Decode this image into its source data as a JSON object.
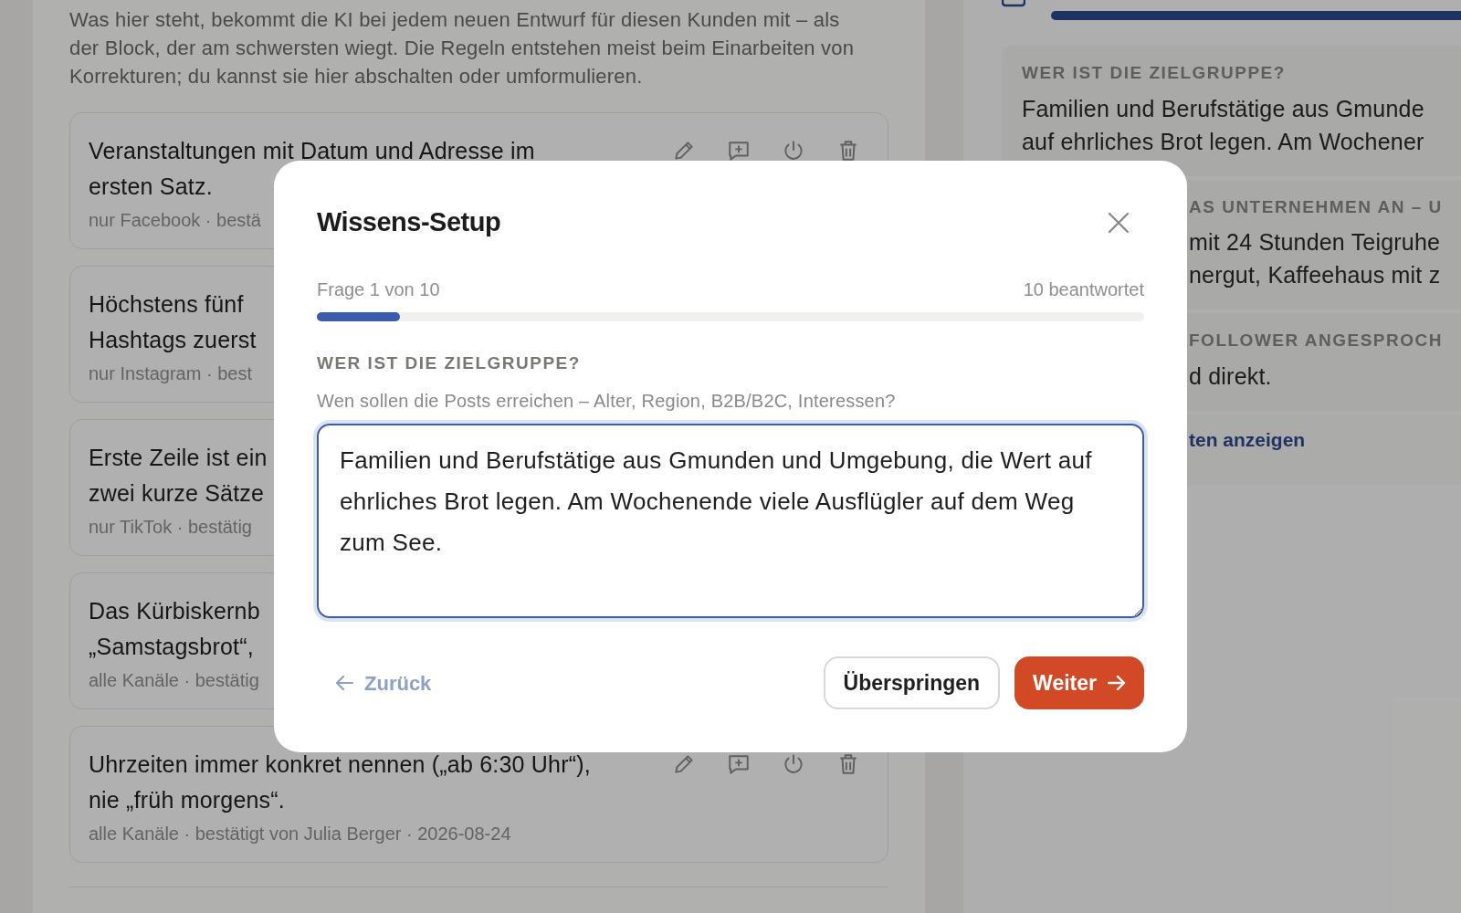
{
  "intro": "Was hier steht, bekommt die KI bei jedem neuen Entwurf für diesen Kunden mit – als der Block, der am schwersten wiegt. Die Regeln entstehen meist beim Einarbeiten von Korrekturen; du kannst sie hier abschalten oder umformulieren.",
  "rules": [
    {
      "kind": "full",
      "lines": [
        "Veranstaltungen mit Datum und Adresse im",
        "ersten Satz."
      ],
      "meta": "nur Facebook · bestä"
    },
    {
      "kind": "covered",
      "lines": [
        "Höchstens fünf",
        "Hashtags zuerst"
      ],
      "meta": "nur Instagram · best"
    },
    {
      "kind": "covered",
      "lines": [
        "Erste Zeile ist ein",
        "zwei kurze Sätze"
      ],
      "meta": "nur TikTok · bestätig"
    },
    {
      "kind": "covered",
      "lines": [
        "Das Kürbiskernb",
        "„Samstagsbrot“,"
      ],
      "meta": "alle Kanäle · bestätig"
    },
    {
      "kind": "full",
      "lines": [
        "Uhrzeiten immer konkret nennen („ab 6:30 Uhr“),",
        "nie „früh morgens“."
      ],
      "meta": "alle Kanäle · bestätigt von Julia Berger · 2026-08-24"
    }
  ],
  "answers": [
    {
      "kind": "full",
      "heading": "WER IST DIE ZIELGRUPPE?",
      "lines": [
        "Familien und Berufstätige aus Gmunde",
        "auf ehrliches Brot legen. Am Wochener"
      ]
    },
    {
      "kind": "covered",
      "heading": "AS UNTERNEHMEN AN – U",
      "lines": [
        "mit 24 Stunden Teigruhe",
        "nergut, Kaffeehaus mit z"
      ]
    },
    {
      "kind": "covered",
      "heading": "FOLLOWER ANGESPROCH",
      "lines": [
        "d direkt."
      ]
    }
  ],
  "answers_link": "ten anzeigen",
  "dialog": {
    "title": "Wissens-Setup",
    "step": "Frage 1 von 10",
    "answered": "10 beantwortet",
    "progress": {
      "level": 0.1
    },
    "question": "WER IST DIE ZIELGRUPPE?",
    "hint": "Wen sollen die Posts erreichen – Alter, Region, B2B/B2C, Interessen?",
    "answer": "Familien und Berufstätige aus Gmunden und Umgebung, die Wert auf ehrliches Brot legen. Am Wochenende viele Ausflügler auf dem Weg zum See.",
    "back": {
      "label": "Zurück",
      "disabled": true
    },
    "skip": "Überspringen",
    "next": "Weiter"
  }
}
